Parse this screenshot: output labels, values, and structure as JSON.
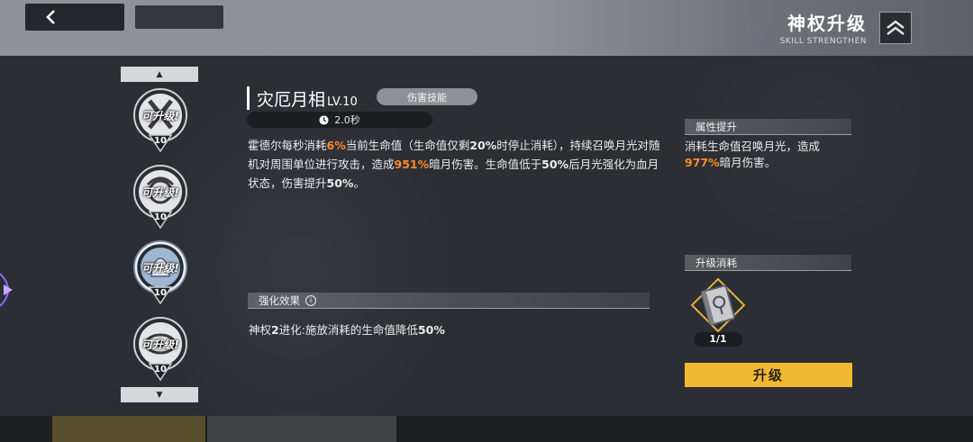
{
  "header": {
    "title": "神权升级",
    "subtitle": "SKILL STRENGTHEN"
  },
  "skill_list": {
    "nodes": [
      {
        "badge": "可升级!",
        "level": "10",
        "icon": "crossed-blades-icon"
      },
      {
        "badge": "可升级!",
        "level": "10",
        "icon": "swirl-emblem-icon"
      },
      {
        "badge": "可升级!",
        "level": "10",
        "icon": "moon-helmet-icon",
        "selected": true
      },
      {
        "badge": "可升级!",
        "level": "10",
        "icon": "ring-emblem-icon"
      }
    ]
  },
  "skill": {
    "name": "灾厄月相",
    "level": "LV.10",
    "type": "伤害技能",
    "cooldown": "2.0秒",
    "desc": {
      "p1": "霍德尔每秒消耗",
      "v1": "6%",
      "p2": "当前生命值（生命值仅剩",
      "v2": "20%",
      "p3": "时停止消耗），持续召唤月光对随机对周围单位进行攻击，造成",
      "v3": "951%",
      "p4": "暗月伤害。生命值低于",
      "v4": "50%",
      "p5": "后月光强化为血月状态，伤害提升",
      "v5": "50%",
      "p6": "。"
    },
    "enhance_title": "强化效果",
    "enhance_text": {
      "p1": "神权",
      "v1": "2",
      "p2": "进化:施放消耗的生命值降低",
      "v2": "50%"
    }
  },
  "attribute": {
    "title": "属性提升",
    "line1": "消耗生命值召唤月光，造成",
    "value": "977%",
    "line2": "暗月伤害。"
  },
  "cost": {
    "title": "升级消耗",
    "item_icon": "tome-icon",
    "count": "1/1"
  },
  "upgrade_button": "升级",
  "colors": {
    "highlight": "#ff8a2a",
    "button": "#f1b931"
  }
}
